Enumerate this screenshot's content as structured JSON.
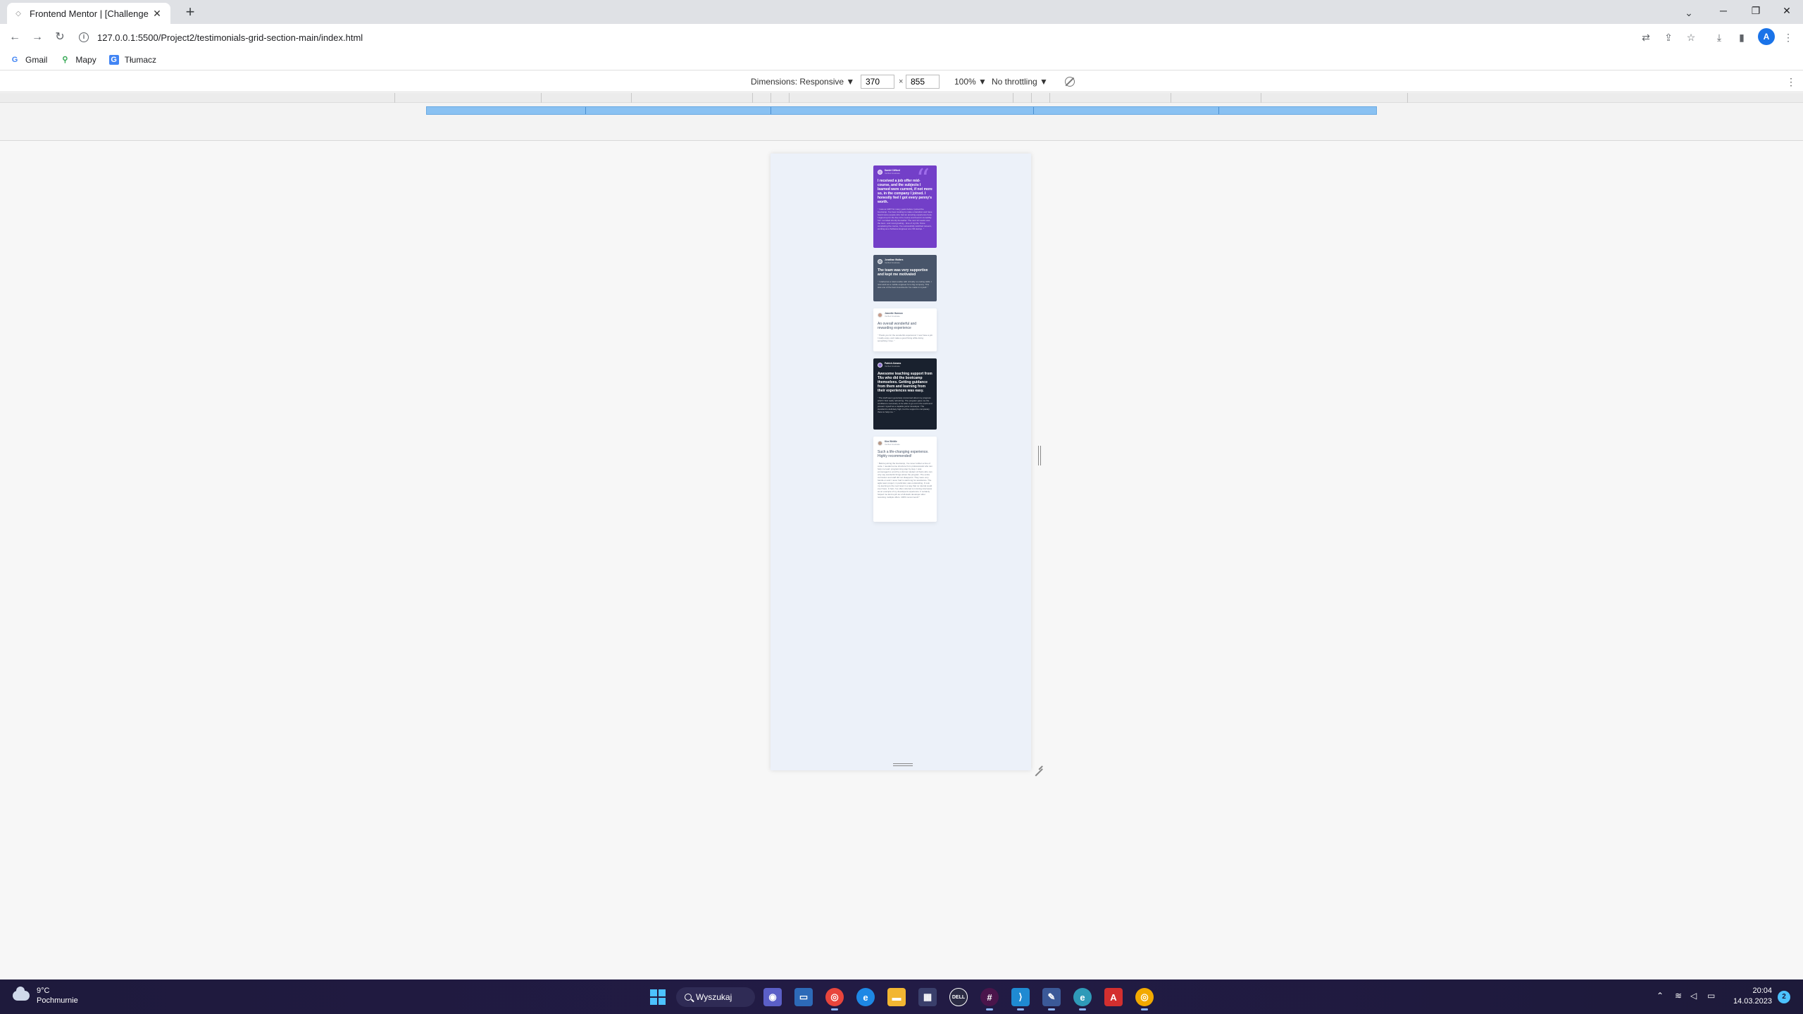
{
  "browser": {
    "tab_title": "Frontend Mentor | [Challenge Na",
    "url": "127.0.0.1:5500/Project2/testimonials-grid-section-main/index.html",
    "bookmarks": [
      {
        "label": "Gmail",
        "icon": "google-icon"
      },
      {
        "label": "Mapy",
        "icon": "maps-pin-icon"
      },
      {
        "label": "Tłumacz",
        "icon": "translate-icon"
      }
    ],
    "profile_initial": "A"
  },
  "devtools": {
    "dimensions_label": "Dimensions: Responsive ▼",
    "width": "370",
    "times": "×",
    "height": "855",
    "zoom": "100% ▼",
    "throttling": "No throttling ▼"
  },
  "testimonials": [
    {
      "name": "Daniel Clifford",
      "role": "Verified Graduate",
      "headline": "I received a job offer mid-course, and the subjects I learned were current, if not more so, in the company I joined. I honestly feel I got every penny's worth.",
      "quote": "“ I was an EMT for many years before I joined the bootcamp. I've been looking to make a transition and have heard some people who had an amazing experience here. I signed up for the free intro course and found it incredibly fun! I enrolled shortly thereafter. The next 12 weeks was the best - and most grueling - time of my life. Since completing the course, I've successfully switched careers, working as a Software Engineer at a VR startup. ”"
    },
    {
      "name": "Jonathan Walters",
      "role": "Verified Graduate",
      "headline": "The team was very supportive and kept me motivated",
      "quote": "“ I started as a total newbie with virtually no coding skills. I now work as a mobile engineer for a big company. This was one of the best investments I've made in myself. ”"
    },
    {
      "name": "Jeanette Harmon",
      "role": "Verified Graduate",
      "headline": "An overall wonderful and rewarding experience",
      "quote": "“ Thank you for the wonderful experience! I now have a job I really enjoy, and make a good living while doing something I love. ”"
    },
    {
      "name": "Patrick Abrams",
      "role": "Verified Graduate",
      "headline": "Awesome teaching support from TAs who did the bootcamp themselves. Getting guidance from them and learning from their experiences was easy.",
      "quote": "“ The staff seem genuinely concerned about my progress which I find really refreshing. The program gave me the confidence necessary to be able to go out in the world and present myself as a capable junior developer. The standard is definitely high, but the support is completely there to help me. ”"
    },
    {
      "name": "Kira Whittle",
      "role": "Verified Graduate",
      "headline": "Such a life-changing experience. Highly recommended!",
      "quote": "“ Before joining the bootcamp, I've never written a line of code. I needed some structure from professionals who can help me learn programming step by step. I was encouraged to enroll by a former student of theirs who can only say wonderful things about the program. The entire curriculum and staff did not disappoint. They were very hands-on and I never had to wait long for assistance. The agile team project, in particular, was outstanding. It took my learning to the next level in a way that no tutorial could ever have. In fact, I've often referred to it during interviews as an example of my developent experience. It certainly helped me land a job as a full-stack developer after receiving multiple offers. 100% recommend! ”"
    }
  ],
  "taskbar": {
    "temperature": "9°C",
    "weather": "Pochmurnie",
    "search_label": "Wyszukaj",
    "time": "20:04",
    "date": "14.03.2023",
    "notification_count": "2"
  },
  "colors": {
    "purple": "#733fc8",
    "grayish_blue": "#48556a",
    "dark_blue": "#19212e",
    "page_bg": "#ecf1f9",
    "media_query_bar": "#89c1f2"
  }
}
